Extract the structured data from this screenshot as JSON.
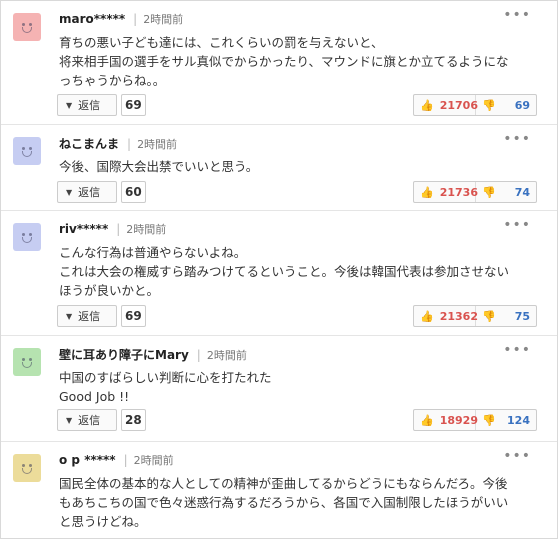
{
  "reply_label": "返信",
  "more_label": "•••",
  "comments": [
    {
      "name": "maro*****",
      "time": "2時間前",
      "avatar_color": "#f5b3b3",
      "lines": [
        "育ちの悪い子ども達には、これくらいの罰を与えないと、",
        "将来相手国の選手をサル真似でからかったり、マウンドに旗とか立てるようにな",
        "っちゃうからね。。"
      ],
      "replies": "69",
      "likes": "21706",
      "dislikes": "69"
    },
    {
      "name": "ねこまんま",
      "time": "2時間前",
      "avatar_color": "#c6cdf2",
      "lines": [
        "今後、国際大会出禁でいいと思う。"
      ],
      "replies": "60",
      "likes": "21736",
      "dislikes": "74"
    },
    {
      "name": "riv*****",
      "time": "2時間前",
      "avatar_color": "#c6cdf2",
      "lines": [
        "こんな行為は普通やらないよね。",
        "これは大会の権威すら踏みつけてるということ。今後は韓国代表は参加させない",
        "ほうが良いかと。"
      ],
      "replies": "69",
      "likes": "21362",
      "dislikes": "75"
    },
    {
      "name": "壁に耳あり障子にMary",
      "time": "2時間前",
      "avatar_color": "#b6e3b0",
      "lines": [
        "中国のすばらしい判断に心を打たれた",
        "Good Job !!"
      ],
      "replies": "28",
      "likes": "18929",
      "dislikes": "124"
    },
    {
      "name": "o p *****",
      "time": "2時間前",
      "avatar_color": "#ecdc9a",
      "lines": [
        "国民全体の基本的な人としての精神が歪曲してるからどうにもならんだろ。今後",
        "もあちこちの国で色々迷惑行為するだろうから、各国で入国制限したほうがいい",
        "と思うけどね。"
      ]
    }
  ]
}
